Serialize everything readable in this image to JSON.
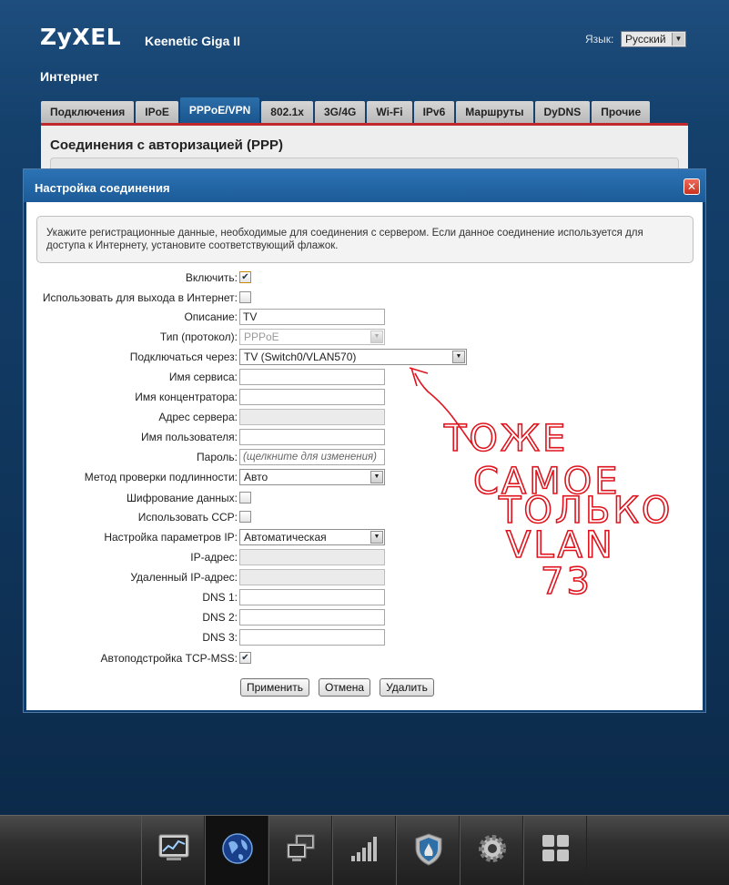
{
  "header": {
    "brand": "ZyXEL",
    "model": "Keenetic Giga II",
    "language_label": "Язык:",
    "language_value": "Русский",
    "section_title": "Интернет"
  },
  "tabs": [
    {
      "label": "Подключения",
      "active": false
    },
    {
      "label": "IPoE",
      "active": false
    },
    {
      "label": "PPPoE/VPN",
      "active": true
    },
    {
      "label": "802.1x",
      "active": false
    },
    {
      "label": "3G/4G",
      "active": false
    },
    {
      "label": "Wi-Fi",
      "active": false
    },
    {
      "label": "IPv6",
      "active": false
    },
    {
      "label": "Маршруты",
      "active": false
    },
    {
      "label": "DyDNS",
      "active": false
    },
    {
      "label": "Прочие",
      "active": false
    }
  ],
  "background_panel": {
    "title": "Соединения с авторизацией (PPP)"
  },
  "dialog": {
    "title": "Настройка соединения",
    "close_symbol": "✕",
    "info_text": "Укажите регистрационные данные, необходимые для соединения с сервером. Если данное соединение используется для доступа к Интернету, установите соответствующий флажок.",
    "fields": {
      "enable": {
        "label": "Включить:",
        "checked": true
      },
      "use_for_internet": {
        "label": "Использовать для выхода в Интернет:",
        "checked": false
      },
      "description": {
        "label": "Описание:",
        "value": "TV"
      },
      "protocol": {
        "label": "Тип (протокол):",
        "value": "PPPoE"
      },
      "connect_via": {
        "label": "Подключаться через:",
        "value": "TV (Switch0/VLAN570)"
      },
      "service_name": {
        "label": "Имя сервиса:",
        "value": ""
      },
      "concentrator_name": {
        "label": "Имя концентратора:",
        "value": ""
      },
      "server_address": {
        "label": "Адрес сервера:",
        "value": ""
      },
      "username": {
        "label": "Имя пользователя:",
        "value": ""
      },
      "password": {
        "label": "Пароль:",
        "value": "(щелкните для изменения)"
      },
      "auth_method": {
        "label": "Метод проверки подлинности:",
        "value": "Авто"
      },
      "encryption": {
        "label": "Шифрование данных:",
        "checked": false
      },
      "use_ccp": {
        "label": "Использовать CCP:",
        "checked": false
      },
      "ip_settings": {
        "label": "Настройка параметров IP:",
        "value": "Автоматическая"
      },
      "ip_address": {
        "label": "IP-адрес:",
        "value": ""
      },
      "remote_ip": {
        "label": "Удаленный IP-адрес:",
        "value": ""
      },
      "dns1": {
        "label": "DNS 1:",
        "value": ""
      },
      "dns2": {
        "label": "DNS 2:",
        "value": ""
      },
      "dns3": {
        "label": "DNS 3:",
        "value": ""
      },
      "tcp_mss": {
        "label": "Автоподстройка TCP-MSS:",
        "checked": true
      }
    },
    "buttons": {
      "apply": "Применить",
      "cancel": "Отмена",
      "delete": "Удалить"
    }
  },
  "annotation": {
    "color": "#e0141e",
    "lines": [
      "ТОЖЕ",
      "САМОЕ",
      "ТОЛЬКО",
      "VLAN",
      "73"
    ]
  },
  "bottom_nav": [
    {
      "icon": "monitor-chart-icon",
      "active": false
    },
    {
      "icon": "globe-icon",
      "active": true
    },
    {
      "icon": "network-computers-icon",
      "active": false
    },
    {
      "icon": "signal-bars-icon",
      "active": false
    },
    {
      "icon": "shield-icon",
      "active": false
    },
    {
      "icon": "gear-icon",
      "active": false
    },
    {
      "icon": "apps-grid-icon",
      "active": false
    }
  ]
}
